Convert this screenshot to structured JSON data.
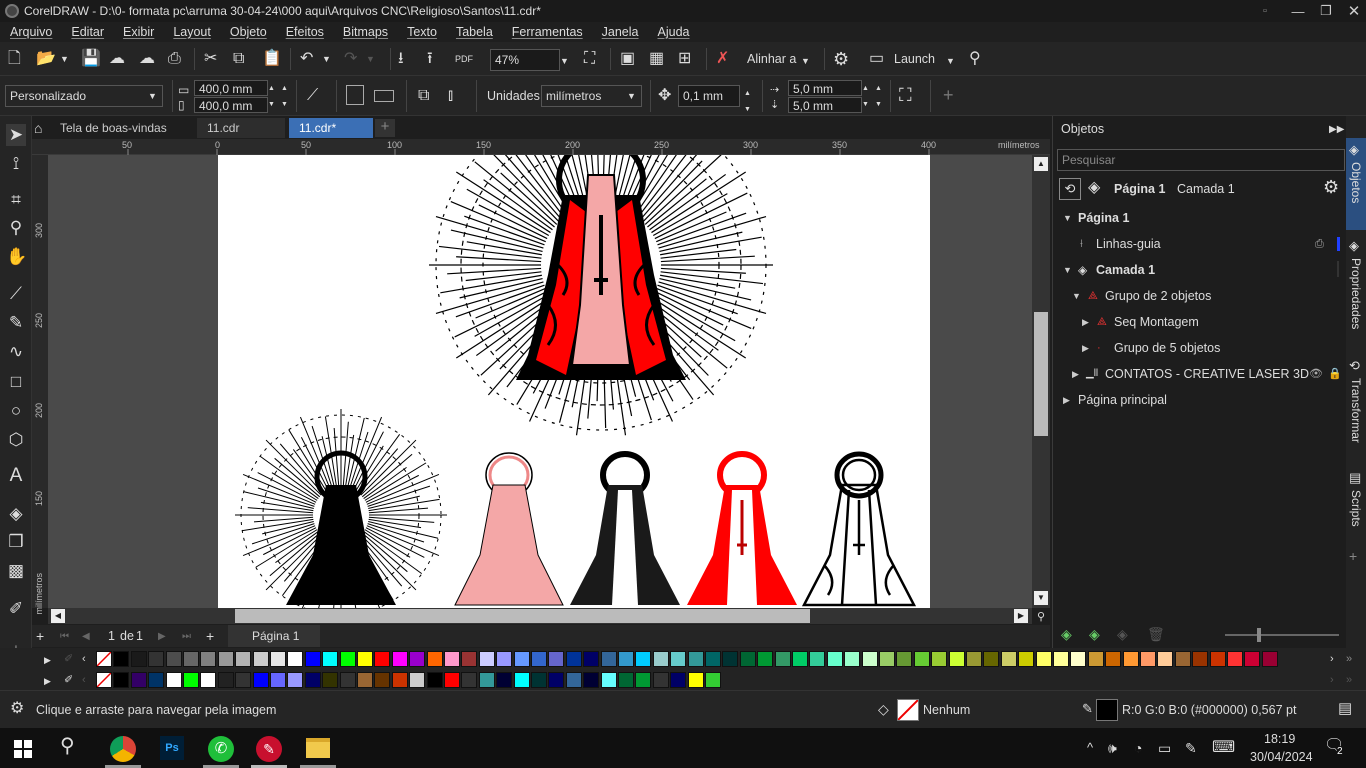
{
  "window": {
    "title": "CorelDRAW - D:\\0- formata pc\\arruma 30-04-24\\000 aqui\\Arquivos CNC\\Religioso\\Santos\\11.cdr*"
  },
  "menu": [
    "Arquivo",
    "Editar",
    "Exibir",
    "Layout",
    "Objeto",
    "Efeitos",
    "Bitmaps",
    "Texto",
    "Tabela",
    "Ferramentas",
    "Janela",
    "Ajuda"
  ],
  "toolbar": {
    "zoom": "47%",
    "align_label": "Alinhar a",
    "launch_label": "Launch"
  },
  "propbar": {
    "page_preset": "Personalizado",
    "width": "400,0 mm",
    "height": "400,0 mm",
    "units_label": "Unidades:",
    "units_value": "milímetros",
    "nudge": "0,1 mm",
    "dup_x": "5,0 mm",
    "dup_y": "5,0 mm"
  },
  "tabs": [
    {
      "label": "Tela de boas-vindas",
      "active": false
    },
    {
      "label": "11.cdr",
      "active": false
    },
    {
      "label": "11.cdr*",
      "active": true
    }
  ],
  "ruler": {
    "top_ticks": [
      "50",
      "0",
      "50",
      "100",
      "150",
      "200",
      "250",
      "300",
      "350",
      "400"
    ],
    "unit": "milímetros",
    "left_ticks": [
      "300",
      "250",
      "200",
      "150"
    ],
    "left_unit": "milímetros"
  },
  "pagenav": {
    "current": "1",
    "of_label": "de",
    "total": "1",
    "page_tab": "Página 1"
  },
  "objects_panel": {
    "title": "Objetos",
    "search_placeholder": "Pesquisar",
    "header_page": "Página 1",
    "header_layer": "Camada 1",
    "tree": [
      {
        "label": "Página 1",
        "level": 0,
        "expanded": true,
        "bold": true
      },
      {
        "label": "Linhas-guia",
        "level": 1,
        "expanded": null,
        "bold": false
      },
      {
        "label": "Camada 1",
        "level": 0,
        "expanded": true,
        "bold": true
      },
      {
        "label": "Grupo de 2 objetos",
        "level": 1,
        "expanded": true,
        "bold": false
      },
      {
        "label": "Seq Montagem",
        "level": 2,
        "expanded": false,
        "bold": false
      },
      {
        "label": "Grupo de 5 objetos",
        "level": 2,
        "expanded": false,
        "bold": false
      },
      {
        "label": "CONTATOS - CREATIVE LASER 3D",
        "level": 1,
        "expanded": false,
        "bold": false
      },
      {
        "label": "Página principal",
        "level": 0,
        "expanded": false,
        "bold": false
      }
    ]
  },
  "side_tabs": [
    "Objetos",
    "Propriedades",
    "Transformar",
    "Scripts"
  ],
  "status": {
    "hint": "Clique e arraste para navegar pela imagem",
    "fill_label": "Nenhum",
    "outline": "R:0 G:0 B:0 (#000000)  0,567 pt"
  },
  "taskbar": {
    "time": "18:19",
    "date": "30/04/2024",
    "notifications": "2"
  },
  "colors": {
    "accent": "#3b6fb5",
    "mantle_red": "#ff0000",
    "dress_pink": "#f4a7a7"
  },
  "palette1": [
    "#ffffff",
    "#000000",
    "#1a1a1a",
    "#333333",
    "#4d4d4d",
    "#666666",
    "#808080",
    "#999999",
    "#b3b3b3",
    "#cccccc",
    "#e6e6e6",
    "#ffffff",
    "#0000ff",
    "#00ffff",
    "#00ff00",
    "#ffff00",
    "#ff0000",
    "#ff00ff",
    "#9900cc",
    "#ff6600",
    "#ff99cc",
    "#993333",
    "#ccccff",
    "#9999ff",
    "#6699ff",
    "#3366cc",
    "#6666cc",
    "#003399",
    "#000066",
    "#336699",
    "#3399cc",
    "#00ccff",
    "#99cccc",
    "#66cccc",
    "#339999",
    "#006666",
    "#003333",
    "#006633",
    "#009933",
    "#339966",
    "#00cc66",
    "#33cc99",
    "#66ffcc",
    "#99ffcc",
    "#ccffcc",
    "#99cc66",
    "#669933",
    "#66cc33",
    "#99cc33",
    "#ccff33",
    "#999933",
    "#666600",
    "#cccc66",
    "#cccc00",
    "#ffff66",
    "#ffff99",
    "#ffffcc",
    "#cc9933",
    "#cc6600",
    "#ff9933",
    "#ff9966",
    "#ffcc99",
    "#996633",
    "#993300",
    "#cc3300",
    "#ff3333",
    "#cc0033",
    "#990033"
  ],
  "palette2": [
    "#ffffff",
    "#000000",
    "#330066",
    "#003366",
    "#ffffff",
    "#00ff00",
    "#ffffff",
    "#222222",
    "#333333",
    "#0000ff",
    "#6666ff",
    "#9999ff",
    "#000066",
    "#333300",
    "#333333",
    "#996633",
    "#663300",
    "#cc3300",
    "#cccccc",
    "#000000",
    "#ff0000",
    "#333333",
    "#339999",
    "#000033",
    "#00ffff",
    "#003333",
    "#000066",
    "#336699",
    "#000033",
    "#66ffff",
    "#006633",
    "#009933",
    "#333333",
    "#000066",
    "#ffff00",
    "#33cc33"
  ]
}
